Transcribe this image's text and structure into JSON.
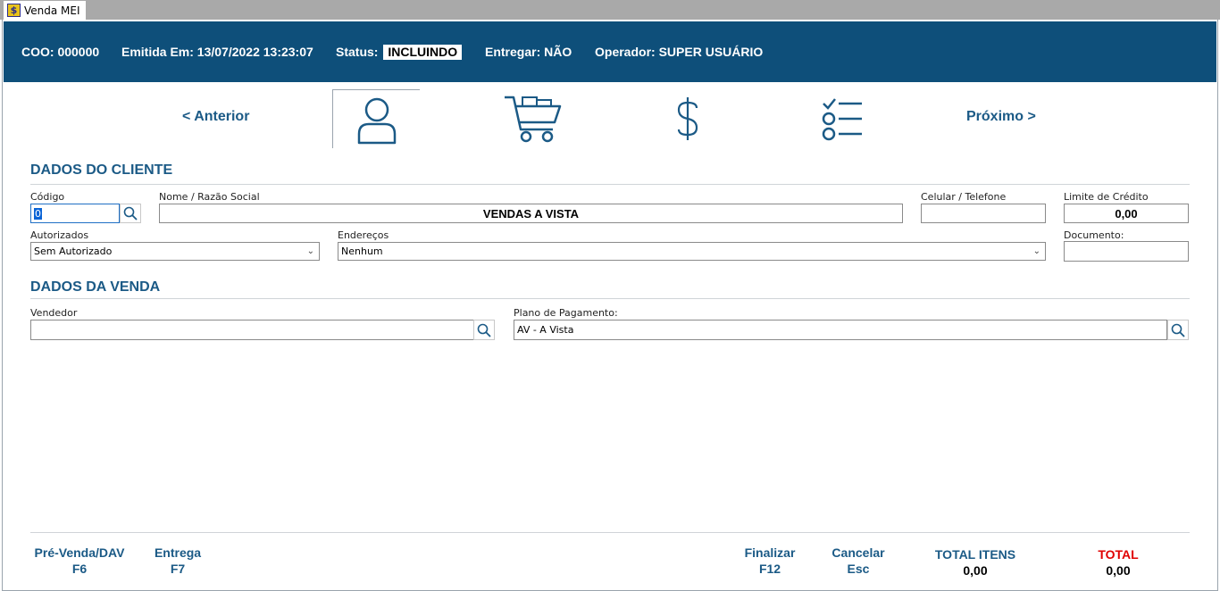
{
  "window": {
    "tab_title": "Venda MEI",
    "tab_icon": "app-icon"
  },
  "header": {
    "coo_label": "COO:",
    "coo_value": "000000",
    "emitida_label": "Emitida Em:",
    "emitida_value": "13/07/2022 13:23:07",
    "status_label": "Status:",
    "status_value": "INCLUINDO",
    "entregar_label": "Entregar:",
    "entregar_value": "NÃO",
    "operador_label": "Operador:",
    "operador_value": "SUPER USUÁRIO"
  },
  "steps": {
    "prev_label": "< Anterior",
    "next_label": "Próximo >",
    "items": [
      {
        "icon": "user-icon",
        "active": true
      },
      {
        "icon": "shopping-cart-icon",
        "active": false
      },
      {
        "icon": "dollar-icon",
        "active": false
      },
      {
        "icon": "checklist-icon",
        "active": false
      }
    ]
  },
  "cliente": {
    "section_title": "DADOS DO CLIENTE",
    "codigo_label": "Código",
    "codigo_value": "0",
    "nome_label": "Nome / Razão Social",
    "nome_value": "VENDAS A VISTA",
    "celular_label": "Celular / Telefone",
    "celular_value": "",
    "limite_label": "Limite de Crédito",
    "limite_value": "0,00",
    "autorizados_label": "Autorizados",
    "autorizados_value": "Sem Autorizado",
    "enderecos_label": "Endereços",
    "enderecos_value": "Nenhum",
    "documento_label": "Documento:",
    "documento_value": ""
  },
  "venda": {
    "section_title": "DADOS DA VENDA",
    "vendedor_label": "Vendedor",
    "vendedor_value": "",
    "plano_label": "Plano de Pagamento:",
    "plano_value": "AV - A Vista"
  },
  "footer": {
    "prevenda_label": "Pré-Venda/DAV",
    "prevenda_key": "F6",
    "entrega_label": "Entrega",
    "entrega_key": "F7",
    "finalizar_label": "Finalizar",
    "finalizar_key": "F12",
    "cancelar_label": "Cancelar",
    "cancelar_key": "Esc",
    "total_itens_label": "TOTAL ITENS",
    "total_itens_value": "0,00",
    "total_label": "TOTAL",
    "total_value": "0,00"
  },
  "colors": {
    "header_bg": "#0e4f7a",
    "accent": "#1b5a86",
    "total_label": "#e00000"
  }
}
